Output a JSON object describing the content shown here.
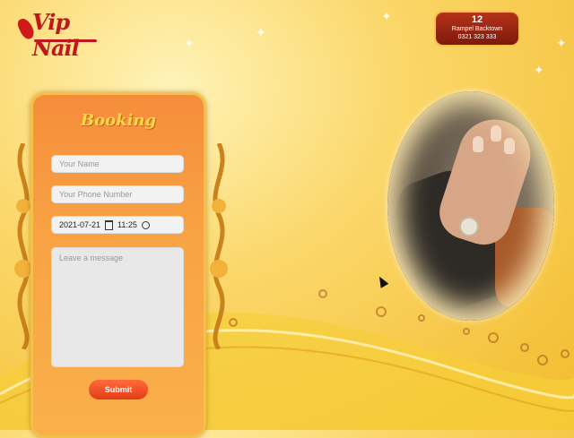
{
  "colors": {
    "accent": "#f58d3a",
    "brand": "#c0181d",
    "submit": "#e63c16"
  },
  "header": {
    "logo_text": "Vip Nail",
    "address": {
      "number": "12",
      "street": "Rampel Backtown",
      "phone": "0321 323 333"
    }
  },
  "booking": {
    "title": "Booking",
    "name_placeholder": "Your Name",
    "phone_placeholder": "Your Phone Number",
    "date_value": "2021-07-21",
    "time_value": "11:25",
    "message_placeholder": "Leave a message",
    "submit_label": "Submit"
  },
  "icons": {
    "calendar": "calendar-icon",
    "clock": "clock-icon"
  }
}
